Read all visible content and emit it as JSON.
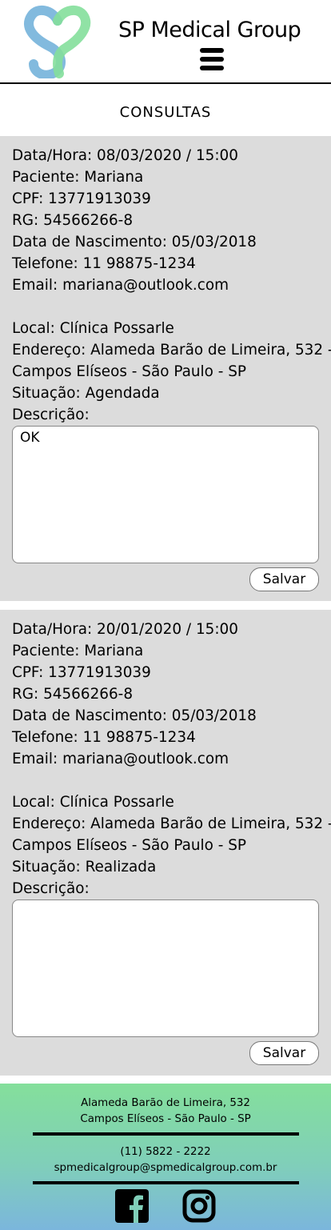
{
  "header": {
    "brand": "SP Medical Group",
    "logo_icon": "heart-sp-logo-icon",
    "menu_icon": "hamburger-menu-icon"
  },
  "page": {
    "title": "CONSULTAS"
  },
  "colors": {
    "card_background": "#dcdcdc",
    "logo_blue": "#7bb6dc",
    "logo_green": "#84df9b",
    "footer_gradient_top": "#84df9b",
    "footer_gradient_bottom": "#7bb6dc"
  },
  "appointments": [
    {
      "datetime": "Data/Hora: 08/03/2020 / 15:00",
      "patient": "Paciente: Mariana",
      "cpf": "CPF: 13771913039",
      "rg": "RG: 54566266-8",
      "birth": "Data de Nascimento: 05/03/2018",
      "phone": "Telefone: 11 98875-1234",
      "email": "Email: mariana@outlook.com",
      "place": "Local: Clínica Possarle",
      "address_line1": "Endereço: Alameda Barão de Limeira, 532 -",
      "address_line2": "Campos Elíseos - São Paulo - SP",
      "status": "Situação: Agendada",
      "description_label": "Descrição:",
      "description_value": "OK",
      "save_label": "Salvar"
    },
    {
      "datetime": "Data/Hora: 20/01/2020 / 15:00",
      "patient": "Paciente: Mariana",
      "cpf": "CPF: 13771913039",
      "rg": "RG: 54566266-8",
      "birth": "Data de Nascimento: 05/03/2018",
      "phone": "Telefone: 11 98875-1234",
      "email": "Email: mariana@outlook.com",
      "place": "Local: Clínica Possarle",
      "address_line1": "Endereço: Alameda Barão de Limeira, 532 -",
      "address_line2": "Campos Elíseos - São Paulo - SP",
      "status": "Situação: Realizada",
      "description_label": "Descrição:",
      "description_value": "",
      "save_label": "Salvar"
    }
  ],
  "footer": {
    "address_line1": "Alameda Barão de Limeira, 532",
    "address_line2": "Campos Elíseos - São Paulo - SP",
    "phone": "(11) 5822 - 2222",
    "email": "spmedicalgroup@spmedicalgroup.com.br",
    "social": [
      {
        "icon": "facebook-icon"
      },
      {
        "icon": "instagram-icon"
      }
    ]
  }
}
